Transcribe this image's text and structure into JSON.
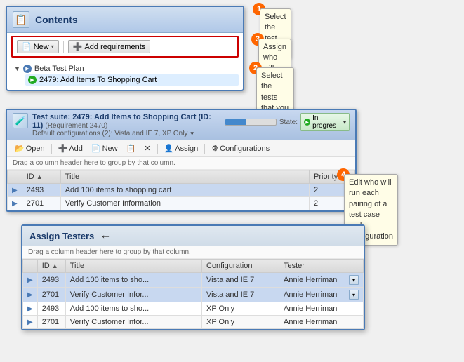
{
  "contents": {
    "title": "Contents",
    "toolbar": {
      "new_label": "New",
      "add_requirements_label": "Add requirements"
    },
    "tree": {
      "beta_plan": "Beta Test Plan",
      "child_item": "2479: Add Items To Shopping Cart"
    }
  },
  "callouts": {
    "c1_number": "1",
    "c1_text": "Select the test suite",
    "c2_number": "2",
    "c2_text": "Select the tests that you want to assign to different testers",
    "c3_number": "3",
    "c3_text": "Assign who will run the tests",
    "c4_number": "4",
    "c4_text": "Edit who will run each pairing of a test case and configuration"
  },
  "testsuite": {
    "title": "Test suite: 2479: Add Items to Shopping Cart (ID: 11)",
    "requirement": "(Requirement 2470)",
    "config_label": "Default configurations (2): Vista and IE 7, XP Only",
    "state_label": "State:",
    "state_value": "In progres",
    "toolbar": {
      "open": "Open",
      "add": "Add",
      "new": "New",
      "delete": "✕",
      "assign": "Assign",
      "configurations": "Configurations"
    },
    "group_hint": "Drag a column header here to group by that column.",
    "columns": [
      "ID",
      "Title",
      "Priority"
    ],
    "rows": [
      {
        "id": "2493",
        "title": "Add 100 items to shopping cart",
        "priority": "2"
      },
      {
        "id": "2701",
        "title": "Verify Customer Information",
        "priority": "2"
      }
    ]
  },
  "assign": {
    "title": "Assign Testers",
    "group_hint": "Drag a column header here to group by that column.",
    "columns": [
      "ID",
      "Title",
      "Configuration",
      "Tester"
    ],
    "rows": [
      {
        "id": "2493",
        "title": "Add 100 items to sho...",
        "config": "Vista and IE 7",
        "tester": "Annie Herriman",
        "highlight": true
      },
      {
        "id": "2701",
        "title": "Verify Customer Infor...",
        "config": "Vista and IE 7",
        "tester": "Annie Herriman",
        "highlight": true
      },
      {
        "id": "2493",
        "title": "Add 100 items to sho...",
        "config": "XP Only",
        "tester": "Annie Herriman",
        "highlight": false
      },
      {
        "id": "2701",
        "title": "Verify Customer Infor...",
        "config": "XP Only",
        "tester": "Annie Herriman",
        "highlight": false
      }
    ]
  }
}
